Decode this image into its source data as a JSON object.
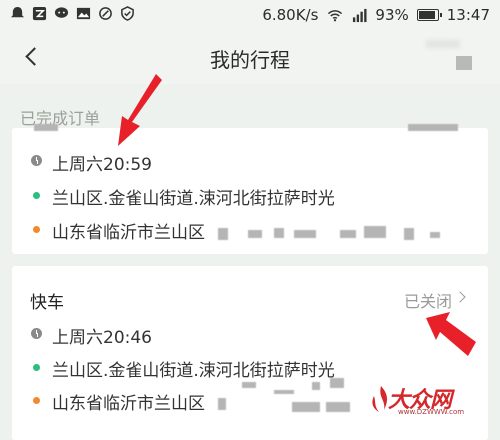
{
  "status_bar": {
    "speed": "6.80K/s",
    "battery_percent": "93%",
    "battery_level": 0.93,
    "time": "13:47",
    "icons": [
      "notification-icon",
      "qzone-icon",
      "wechat-icon",
      "gallery-icon",
      "nfc-icon",
      "vpn-icon",
      "wifi-icon",
      "signal-icon",
      "battery-icon"
    ]
  },
  "nav": {
    "title": "我的行程"
  },
  "section_label": "已完成订单",
  "cards": [
    {
      "type": "",
      "status": "",
      "time": "上周六20:59",
      "start": "兰山区.金雀山街道.涑河北街拉萨时光",
      "end": "山东省临沂市兰山区"
    },
    {
      "type": "快车",
      "status": "已关闭",
      "time": "上周六20:46",
      "start": "兰山区.金雀山街道.涑河北街拉萨时光",
      "end": "山东省临沂市兰山区"
    }
  ],
  "watermark": {
    "brand": "大众网",
    "url": "www.DZWWW.com"
  },
  "colors": {
    "start_dot": "#2dbd7e",
    "end_dot": "#f08a2c",
    "arrow": "#e8202a",
    "background": "#eef2ee"
  }
}
